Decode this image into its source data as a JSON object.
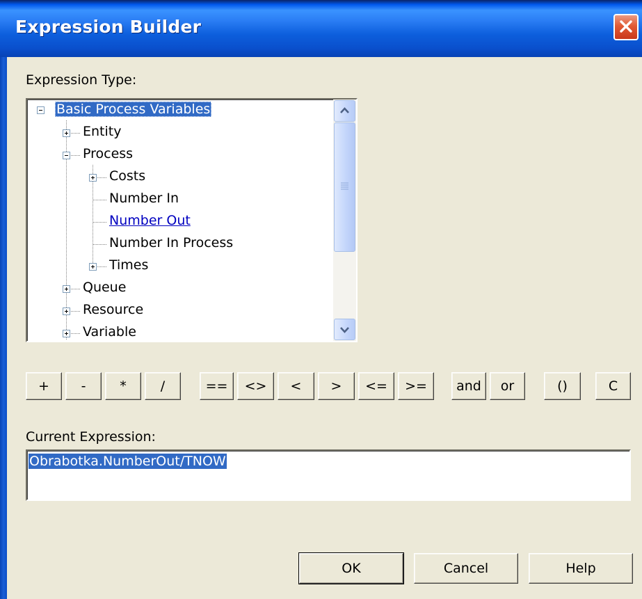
{
  "window": {
    "title": "Expression Builder",
    "close_icon": "close-icon"
  },
  "expression_type": {
    "label": "Expression Type:",
    "tree": [
      {
        "label": "Basic Process Variables",
        "expander": "minus",
        "selected": true
      },
      {
        "label": "Entity",
        "expander": "plus"
      },
      {
        "label": "Process",
        "expander": "minus"
      },
      {
        "label": "Costs",
        "expander": "plus"
      },
      {
        "label": "Number In",
        "expander": "none"
      },
      {
        "label": "Number Out",
        "expander": "none",
        "hot": true
      },
      {
        "label": "Number In Process",
        "expander": "none"
      },
      {
        "label": "Times",
        "expander": "plus"
      },
      {
        "label": "Queue",
        "expander": "plus"
      },
      {
        "label": "Resource",
        "expander": "plus"
      },
      {
        "label": "Variable",
        "expander": "plus"
      }
    ]
  },
  "operators": [
    "+",
    "-",
    "*",
    "/",
    "==",
    "<>",
    "<",
    ">",
    "<=",
    ">=",
    "and",
    "or",
    "()",
    "C"
  ],
  "current_expression": {
    "label": "Current Expression:",
    "value": "Obrabotka.NumberOut/TNOW"
  },
  "footer": {
    "ok": "OK",
    "cancel": "Cancel",
    "help": "Help"
  },
  "colors": {
    "selection": "#316ac5",
    "dialog_bg": "#ece9d8",
    "titlebar": "#0a4fcc"
  }
}
